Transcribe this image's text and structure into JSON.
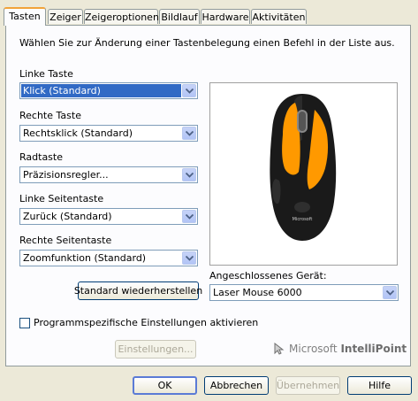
{
  "tabs": [
    "Tasten",
    "Zeiger",
    "Zeigeroptionen",
    "Bildlauf",
    "Hardware",
    "Aktivitäten"
  ],
  "intro": "Wählen Sie zur Änderung einer Tastenbelegung einen Befehl in der Liste aus.",
  "buttons_config": [
    {
      "label": "Linke Taste",
      "value": "Klick (Standard)"
    },
    {
      "label": "Rechte Taste",
      "value": "Rechtsklick (Standard)"
    },
    {
      "label": "Radtaste",
      "value": "Präzisionsregler..."
    },
    {
      "label": "Linke Seitentaste",
      "value": "Zurück (Standard)"
    },
    {
      "label": "Rechte Seitentaste",
      "value": "Zoomfunktion (Standard)"
    }
  ],
  "restore_label": "Standard wiederherstellen",
  "device": {
    "label": "Angeschlossenes Gerät:",
    "value": "Laser Mouse 6000"
  },
  "mouse_logo": "Microsoft",
  "program_specific": {
    "label": "Programmspezifische Einstellungen aktivieren",
    "checked": false
  },
  "settings_label": "Einstellungen...",
  "brand": {
    "part1": "Microsoft",
    "part2": "IntelliPoint"
  },
  "footer": {
    "ok": "OK",
    "cancel": "Abbrechen",
    "apply": "Übernehmen",
    "help": "Hilfe"
  },
  "colors": {
    "highlight": "#316ac5",
    "mouse_accent": "#ff9900",
    "mouse_body": "#1a1a1a"
  }
}
